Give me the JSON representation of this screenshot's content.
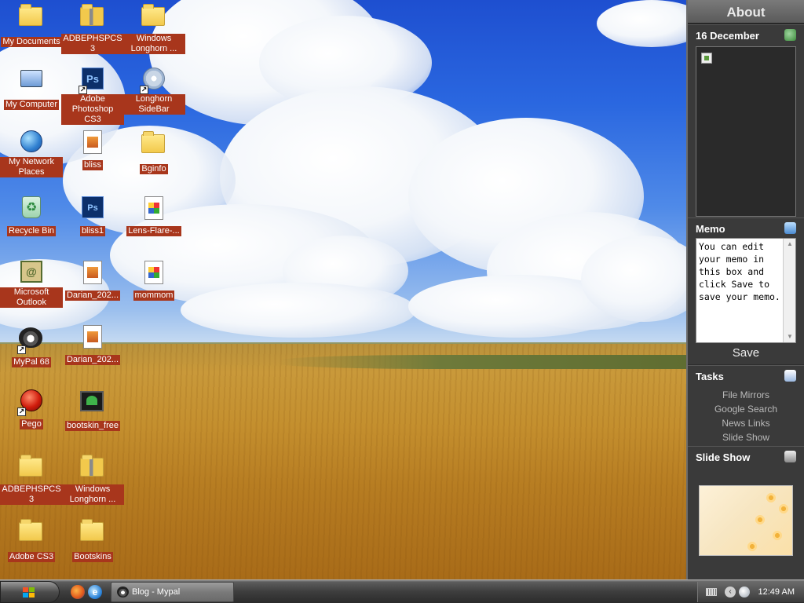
{
  "desktop_icons": [
    {
      "label": "My Documents",
      "icon": "my-documents-icon"
    },
    {
      "label": "ADBEPHSPCS3",
      "icon": "zip-folder-icon"
    },
    {
      "label": "Windows Longhorn ...",
      "icon": "folder-icon"
    },
    {
      "label": "My Computer",
      "icon": "my-computer-icon"
    },
    {
      "label": "Adobe Photoshop CS3",
      "icon": "photoshop-icon"
    },
    {
      "label": "Longhorn SideBar",
      "icon": "cd-icon"
    },
    {
      "label": "My Network Places",
      "icon": "network-places-icon"
    },
    {
      "label": "bliss",
      "icon": "image-file-icon"
    },
    {
      "label": "Bginfo",
      "icon": "folder-icon"
    },
    {
      "label": "Recycle Bin",
      "icon": "recycle-bin-icon"
    },
    {
      "label": "bliss1",
      "icon": "psd-file-icon"
    },
    {
      "label": "Lens-Flare-...",
      "icon": "image-file-icon"
    },
    {
      "label": "Microsoft Outlook",
      "icon": "outlook-icon"
    },
    {
      "label": "Darian_202...",
      "icon": "image-file-icon"
    },
    {
      "label": "mommom",
      "icon": "image-file-icon"
    },
    {
      "label": "MyPal 68",
      "icon": "mypal-icon"
    },
    {
      "label": "Darian_202...",
      "icon": "image-file-icon"
    },
    {
      "label": "Pego",
      "icon": "pego-icon"
    },
    {
      "label": "bootskin_free",
      "icon": "bootskin-icon"
    },
    {
      "label": "ADBEPHSPCS3",
      "icon": "folder-icon"
    },
    {
      "label": "Windows Longhorn ...",
      "icon": "zip-folder-icon"
    },
    {
      "label": "Adobe CS3",
      "icon": "folder-icon"
    },
    {
      "label": "Bootskins",
      "icon": "folder-icon"
    }
  ],
  "sidebar": {
    "header": "About",
    "calendar": {
      "title": "16 December",
      "icon": "calendar-gadget-icon"
    },
    "memo": {
      "title": "Memo",
      "icon": "memo-gadget-icon",
      "text": "You can edit your memo in this box and click Save to save your memo.",
      "save_label": "Save"
    },
    "tasks": {
      "title": "Tasks",
      "icon": "tasks-gadget-icon",
      "items": [
        "File Mirrors",
        "Google Search",
        "News Links",
        "Slide Show"
      ]
    },
    "slideshow": {
      "title": "Slide Show",
      "icon": "slideshow-gadget-icon"
    }
  },
  "taskbar": {
    "window_button": "Blog - Mypal",
    "clock": "12:49 AM",
    "quick_launch": [
      "firefox-icon",
      "internet-explorer-icon"
    ]
  },
  "colors": {
    "label_bg": "#a8361c",
    "sidebar_bg": "#3a3a3a",
    "taskbar_bg": "#3e3e3e"
  }
}
